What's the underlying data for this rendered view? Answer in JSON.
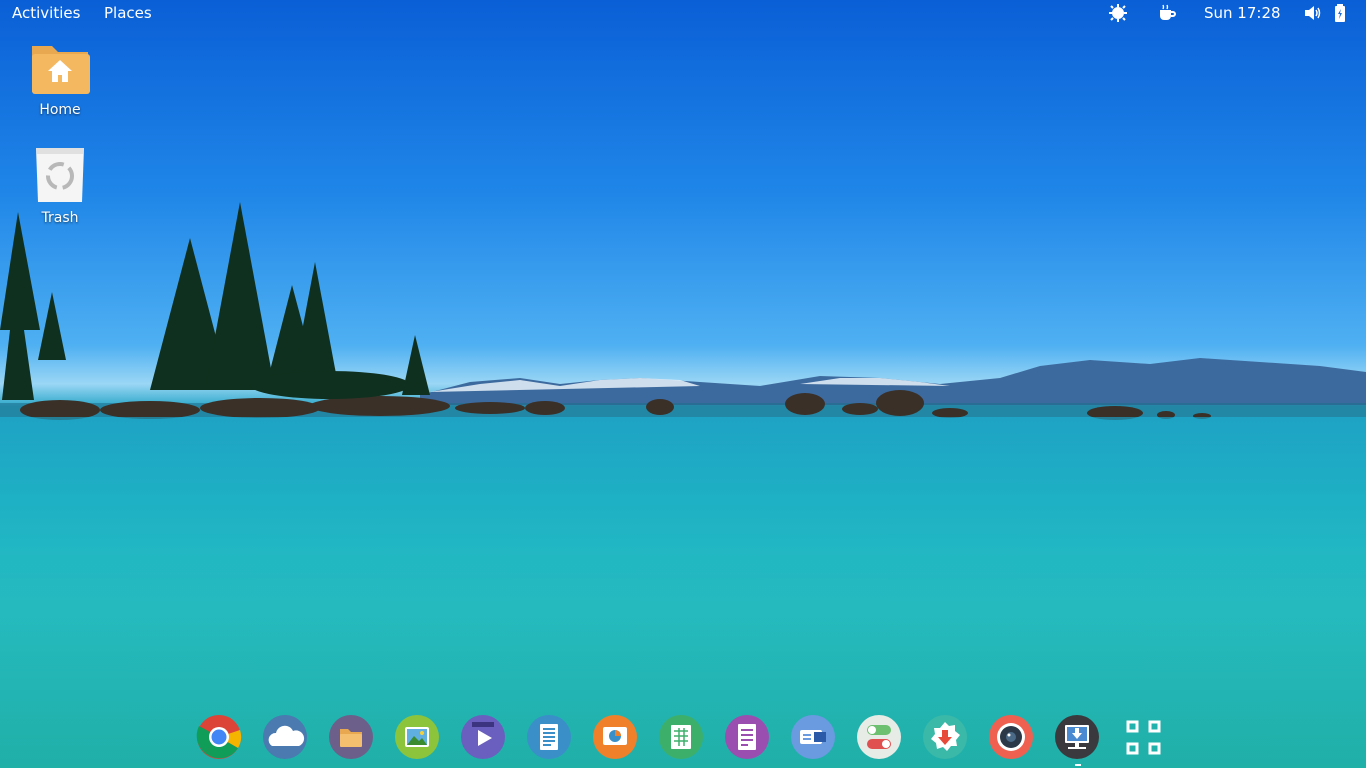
{
  "topbar": {
    "activities": "Activities",
    "places": "Places",
    "clock": "Sun 17:28",
    "icons": [
      "weather-icon",
      "coffee-cup-icon",
      "volume-icon",
      "battery-icon"
    ]
  },
  "desktop": {
    "items": [
      {
        "label": "Home",
        "icon": "home-folder-icon"
      },
      {
        "label": "Trash",
        "icon": "trash-icon"
      }
    ]
  },
  "dock": {
    "apps": [
      "chrome-icon",
      "cloud-icon",
      "files-icon",
      "image-viewer-icon",
      "video-player-icon",
      "text-document-icon",
      "presentation-icon",
      "spreadsheet-icon",
      "document-viewer-icon",
      "remote-desktop-icon",
      "tweaks-toggle-icon",
      "software-update-icon",
      "screen-recorder-icon",
      "download-manager-icon",
      "show-applications-icon"
    ]
  },
  "colors": {
    "sky_top": "#0a5fd6",
    "water": "#1fb4c4",
    "folder": "#f4b860"
  }
}
